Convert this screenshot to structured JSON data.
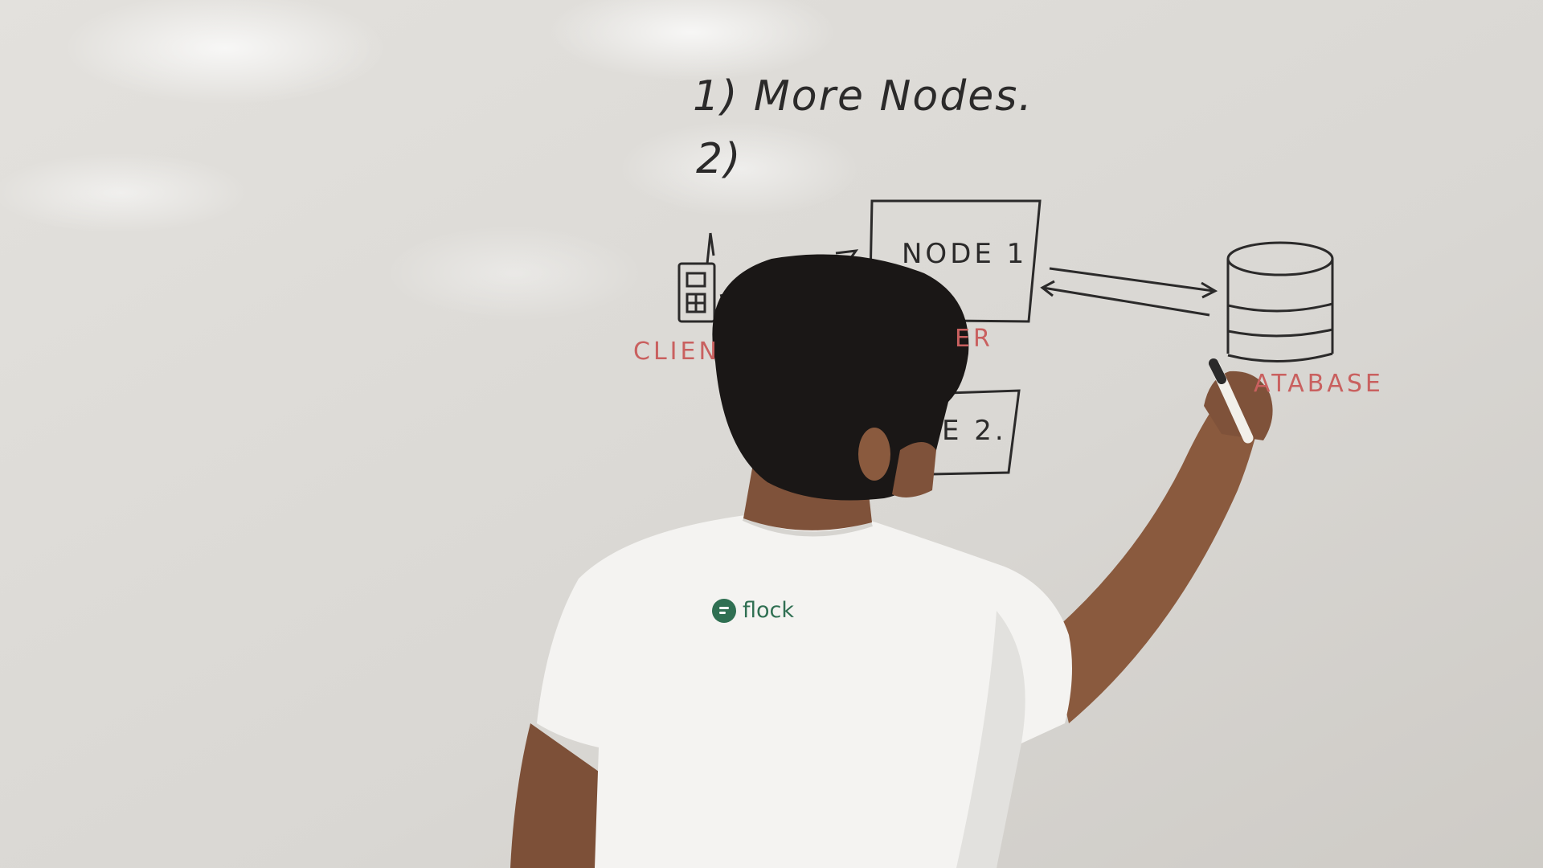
{
  "whiteboard": {
    "item1": "1) More   Nodes.",
    "item2": "2)",
    "node1_label": "NODE 1",
    "node2_label": "E 2.",
    "client_label": "CLIEN",
    "server_label": "ER",
    "database_label": "ATABASE"
  },
  "shirt": {
    "logo_text": "flock"
  },
  "colors": {
    "board": "#dcdad6",
    "ink_black": "#2b2a2a",
    "ink_red": "#c9605f",
    "shirt": "#f4f3f1",
    "hair": "#1a1716",
    "skin": "#8a5a3e",
    "logo_green": "#2f6f52"
  }
}
